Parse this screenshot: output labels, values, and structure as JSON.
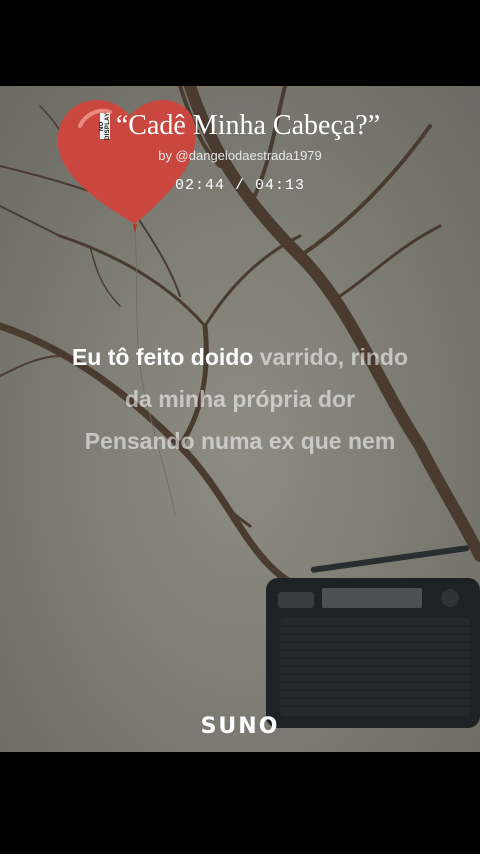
{
  "song": {
    "badge": "NO DISPLAY",
    "title": "“Cadê Minha Cabeça?”",
    "byline": "by @dangelodaestrada1979",
    "time": "02:44 / 04:13"
  },
  "lyrics": [
    {
      "sung": "Eu tô feito doido ",
      "unsung": "varrido, rindo"
    },
    {
      "sung": "",
      "unsung": "da minha própria dor"
    },
    {
      "sung": "",
      "unsung": "Pensando numa ex que nem"
    }
  ],
  "brand": {
    "logo": "SUNO"
  },
  "colors": {
    "balloon": "#c9473f",
    "background": "#85847a",
    "branch": "#4a3b30",
    "radio": "#1f2224"
  },
  "icons": [
    "heart-balloon-icon",
    "radio-icon",
    "tree-icon"
  ]
}
